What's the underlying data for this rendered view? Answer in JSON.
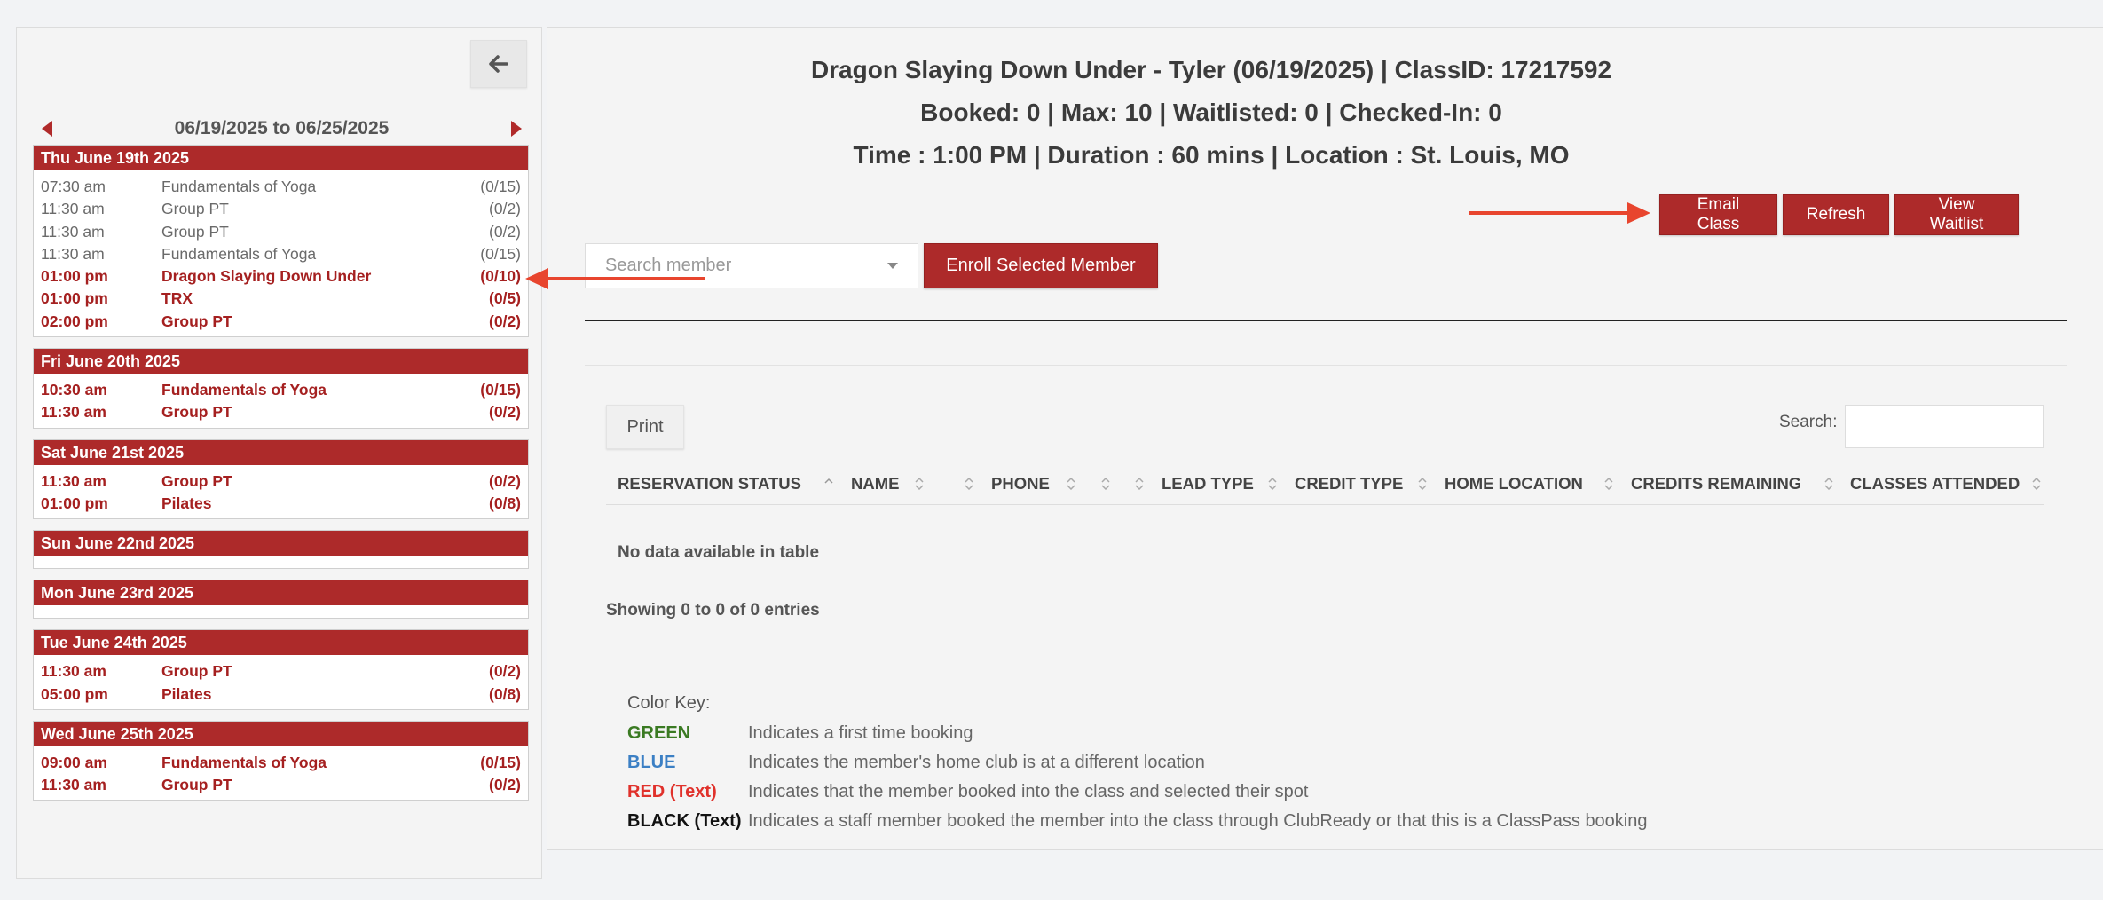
{
  "left": {
    "date_range": "06/19/2025 to 06/25/2025",
    "days": [
      {
        "header": "Thu June 19th 2025",
        "classes": [
          {
            "time": "07:30 am",
            "name": "Fundamentals of Yoga",
            "cap": "(0/15)",
            "state": "past"
          },
          {
            "time": "11:30 am",
            "name": "Group PT",
            "cap": "(0/2)",
            "state": "past"
          },
          {
            "time": "11:30 am",
            "name": "Group PT",
            "cap": "(0/2)",
            "state": "past"
          },
          {
            "time": "11:30 am",
            "name": "Fundamentals of Yoga",
            "cap": "(0/15)",
            "state": "past"
          },
          {
            "time": "01:00 pm",
            "name": "Dragon Slaying Down Under",
            "cap": "(0/10)",
            "state": "selected"
          },
          {
            "time": "01:00 pm",
            "name": "TRX",
            "cap": "(0/5)",
            "state": "future"
          },
          {
            "time": "02:00 pm",
            "name": "Group PT",
            "cap": "(0/2)",
            "state": "future"
          }
        ]
      },
      {
        "header": "Fri June 20th 2025",
        "classes": [
          {
            "time": "10:30 am",
            "name": "Fundamentals of Yoga",
            "cap": "(0/15)",
            "state": "future"
          },
          {
            "time": "11:30 am",
            "name": "Group PT",
            "cap": "(0/2)",
            "state": "future"
          }
        ]
      },
      {
        "header": "Sat June 21st 2025",
        "classes": [
          {
            "time": "11:30 am",
            "name": "Group PT",
            "cap": "(0/2)",
            "state": "future"
          },
          {
            "time": "01:00 pm",
            "name": "Pilates",
            "cap": "(0/8)",
            "state": "future"
          }
        ]
      },
      {
        "header": "Sun June 22nd 2025",
        "classes": []
      },
      {
        "header": "Mon June 23rd 2025",
        "classes": []
      },
      {
        "header": "Tue June 24th 2025",
        "classes": [
          {
            "time": "11:30 am",
            "name": "Group PT",
            "cap": "(0/2)",
            "state": "future"
          },
          {
            "time": "05:00 pm",
            "name": "Pilates",
            "cap": "(0/8)",
            "state": "future"
          }
        ]
      },
      {
        "header": "Wed June 25th 2025",
        "classes": [
          {
            "time": "09:00 am",
            "name": "Fundamentals of Yoga",
            "cap": "(0/15)",
            "state": "future"
          },
          {
            "time": "11:30 am",
            "name": "Group PT",
            "cap": "(0/2)",
            "state": "future"
          }
        ]
      }
    ]
  },
  "main": {
    "title_line1": "Dragon Slaying Down Under - Tyler (06/19/2025) | ClassID: 17217592",
    "title_line2": "Booked: 0 | Max: 10 | Waitlisted: 0 | Checked-In: 0",
    "title_line3": "Time : 1:00 PM | Duration : 60 mins | Location : St. Louis, MO",
    "buttons": {
      "email": "Email Class",
      "refresh": "Refresh",
      "waitlist": "View Waitlist",
      "enroll": "Enroll Selected Member",
      "print": "Print"
    },
    "search_member_placeholder": "Search member",
    "search_label": "Search:",
    "columns": [
      "RESERVATION STATUS",
      "NAME",
      "PHONE",
      "LEAD TYPE",
      "CREDIT TYPE",
      "HOME LOCATION",
      "CREDITS REMAINING",
      "CLASSES ATTENDED"
    ],
    "empty_message": "No data available in table",
    "entries_info": "Showing 0 to 0 of 0 entries",
    "color_key": {
      "title": "Color Key:",
      "rows": [
        {
          "label": "GREEN",
          "color": "#3a7a22",
          "desc": "Indicates a first time booking"
        },
        {
          "label": "BLUE",
          "color": "#3b7fc4",
          "desc": "Indicates the member's home club is at a different location"
        },
        {
          "label": "RED (Text)",
          "color": "#e0312b",
          "desc": "Indicates that the member booked into the class and selected their spot"
        },
        {
          "label": "BLACK (Text)",
          "color": "#111111",
          "desc": "Indicates a staff member booked the member into the class through ClubReady or that this is a ClassPass booking"
        }
      ]
    }
  },
  "colors": {
    "brand_red": "#ad2a2a",
    "annotation_arrow": "#e8452e"
  },
  "icons": {
    "back": "arrow-left-icon",
    "prev": "triangle-left-icon",
    "next": "triangle-right-icon",
    "dropdown": "caret-down-icon",
    "sort": "sort-icon"
  }
}
